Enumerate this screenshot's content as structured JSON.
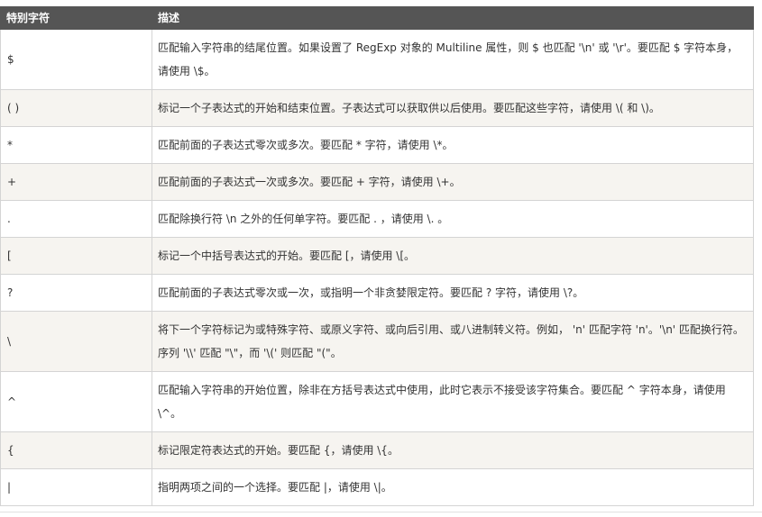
{
  "table": {
    "headers": [
      "特别字符",
      "描述"
    ],
    "rows": [
      {
        "symbol": "$",
        "description": "匹配输入字符串的结尾位置。如果设置了 RegExp 对象的 Multiline 属性，则 $ 也匹配 '\\n' 或 '\\r'。要匹配 $ 字符本身，请使用 \\$。"
      },
      {
        "symbol": "( )",
        "description": "标记一个子表达式的开始和结束位置。子表达式可以获取供以后使用。要匹配这些字符，请使用 \\( 和 \\)。"
      },
      {
        "symbol": "*",
        "description": "匹配前面的子表达式零次或多次。要匹配 * 字符，请使用 \\*。"
      },
      {
        "symbol": "+",
        "description": "匹配前面的子表达式一次或多次。要匹配 + 字符，请使用 \\+。"
      },
      {
        "symbol": ".",
        "description": "匹配除换行符 \\n 之外的任何单字符。要匹配 . ，请使用 \\. 。"
      },
      {
        "symbol": "[",
        "description": "标记一个中括号表达式的开始。要匹配 [，请使用 \\[。"
      },
      {
        "symbol": "?",
        "description": "匹配前面的子表达式零次或一次，或指明一个非贪婪限定符。要匹配 ? 字符，请使用 \\?。"
      },
      {
        "symbol": "\\",
        "description": "将下一个字符标记为或特殊字符、或原义字符、或向后引用、或八进制转义符。例如， 'n' 匹配字符 'n'。'\\n' 匹配换行符。序列 '\\\\' 匹配 \"\\\"，而 '\\(' 则匹配 \"(\"。"
      },
      {
        "symbol": "^",
        "description": "匹配输入字符串的开始位置，除非在方括号表达式中使用，此时它表示不接受该字符集合。要匹配 ^ 字符本身，请使用 \\^。"
      },
      {
        "symbol": "{",
        "description": "标记限定符表达式的开始。要匹配 {，请使用 \\{。"
      },
      {
        "symbol": "|",
        "description": "指明两项之间的一个选择。要匹配 |，请使用 \\|。"
      }
    ]
  }
}
